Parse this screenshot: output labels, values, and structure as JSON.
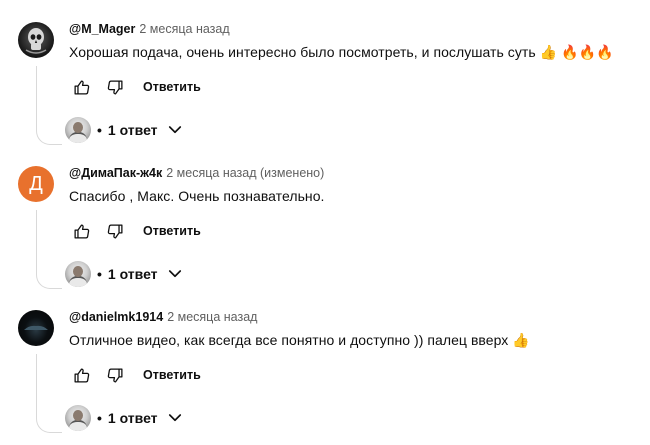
{
  "comments": [
    {
      "author": "@M_Mager",
      "meta": "2 месяца назад",
      "text": "Хорошая подача, очень интересно было посмотреть, и послушать суть 👍 🔥🔥🔥",
      "reply_label": "Ответить",
      "reply_count": "1 ответ",
      "avatar_type": "skull-image"
    },
    {
      "author": "@ДимаПак-ж4к",
      "meta": "2 месяца назад (изменено)",
      "text": "Спасибо , Макс. Очень познавательно.",
      "reply_label": "Ответить",
      "reply_count": "1 ответ",
      "avatar_letter": "Д",
      "avatar_color": "#e8712d"
    },
    {
      "author": "@danielmk1914",
      "meta": "2 месяца назад",
      "text": "Отличное видео, как всегда все понятно и доступно )) палец вверх 👍",
      "reply_label": "Ответить",
      "reply_count": "1 ответ",
      "avatar_type": "dark-image"
    }
  ],
  "separator": "•",
  "icons": {
    "like": "thumbs-up-icon",
    "dislike": "thumbs-down-icon",
    "expand": "chevron-down-icon"
  }
}
